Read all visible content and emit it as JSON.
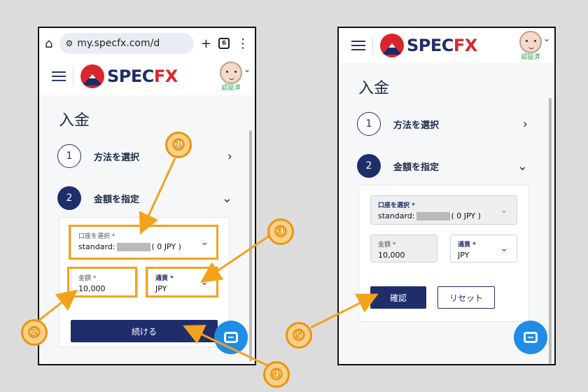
{
  "browser": {
    "url": "my.specfx.com/d",
    "tab_count": "6"
  },
  "site": {
    "logo_spec": "SPEC",
    "logo_fx": "FX",
    "verified_label": "認証済"
  },
  "page": {
    "title": "入金"
  },
  "steps": [
    {
      "num": "1",
      "label": "方法を選択"
    },
    {
      "num": "2",
      "label": "金額を指定"
    }
  ],
  "form": {
    "account_label": "口座を選択 *",
    "account_prefix": "standard:",
    "account_suffix": "( 0 JPY )",
    "amount_label": "金額 *",
    "amount_value": "10,000",
    "currency_label": "通貨 *",
    "currency_value": "JPY"
  },
  "buttons": {
    "continue": "続ける",
    "confirm": "確認",
    "reset": "リセット"
  },
  "callouts": [
    "①",
    "②",
    "③",
    "④",
    "⑤"
  ],
  "colors": {
    "brand_navy": "#1f2d6b",
    "brand_red": "#d9262c",
    "chat_blue": "#1f8ce6",
    "annotation_orange": "#f3a21b"
  }
}
